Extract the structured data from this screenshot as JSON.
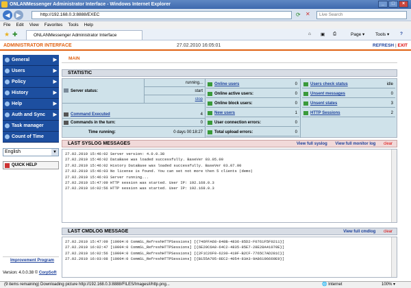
{
  "browser": {
    "window_title": "ONLANMessenger Administrator Interface - Windows Internet Explorer",
    "address": "http://192.168.0.3:8888/EXEC",
    "search_placeholder": "Live Search",
    "menu": [
      "File",
      "Edit",
      "View",
      "Favorites",
      "Tools",
      "Help"
    ],
    "tab_title": "ONLANMessenger Administrator Interface",
    "toolbar": {
      "page": "Page",
      "tools": "Tools"
    },
    "status_text": "(9 items remaining) Downloading picture http://192.168.0.3:8888/FILES/Images/i/http.png...",
    "zone": "Internet",
    "zoom": "100%"
  },
  "app": {
    "header_title": "ADMINISTRATOR INTERFACE",
    "datetime": "27.02.2010 16:05:01",
    "refresh": "REFRESH",
    "exit": "EXIT",
    "main_label": "MAIN",
    "sidebar": [
      {
        "label": "General",
        "arrow": true
      },
      {
        "label": "Users",
        "arrow": true
      },
      {
        "label": "Policy",
        "arrow": true
      },
      {
        "label": "History",
        "arrow": true
      },
      {
        "label": "Help",
        "arrow": true
      },
      {
        "label": "Auth and Sync",
        "arrow": true
      },
      {
        "label": "Task manager",
        "arrow": false
      },
      {
        "label": "Count of Time",
        "arrow": false
      }
    ],
    "language": "English",
    "quick_help": "QUICK HELP",
    "improvement": "Improvement Program",
    "version": "Version: 4.0.0.38",
    "copyright": "CorpSoft"
  },
  "statistic": {
    "title": "STATISTIC",
    "server_status_label": "Server status:",
    "server_state": "running...",
    "start": "start",
    "stop": "stop",
    "commands_executed_label": "Command Executed",
    "commands_executed": "4",
    "commands_turn_label": "Commands in the turn:",
    "commands_turn": "0",
    "time_running_label": "Time running:",
    "time_running": "0 days 00:18:27",
    "col2": [
      {
        "label": "Online users",
        "value": "0",
        "link": true
      },
      {
        "label": "Online active users:",
        "value": "0",
        "link": false
      },
      {
        "label": "Online block users:",
        "value": "0",
        "link": false
      },
      {
        "label": "New users",
        "value": "1",
        "link": true
      },
      {
        "label": "User connection errors:",
        "value": "0",
        "link": false
      },
      {
        "label": "Total upload errors:",
        "value": "0",
        "link": false
      }
    ],
    "col3": [
      {
        "label": "Users check status",
        "value": "idle"
      },
      {
        "label": "Unsent messages",
        "value": "0"
      },
      {
        "label": "Unsent states",
        "value": "3"
      },
      {
        "label": "HTTP Sessions",
        "value": "2"
      }
    ]
  },
  "syslog": {
    "title": "LAST SYSLOG MESSAGES",
    "view_full": "View full syslog",
    "view_monitor": "View full monitor log",
    "clear": "clear",
    "lines": [
      "27.02.2010 15:46:02 Server version: 4.0.0.38",
      "27.02.2010 15:46:02 DataBase was loaded successfully. BaseVer 03.05.00",
      "27.02.2010 15:46:02 History DataBase was loaded successfully. BaseVer 03.07.00",
      "27.02.2010 15:46:03 No license is found. You can set not more then 5 clients (demo)",
      "27.02.2010 15:46:03 Server running...",
      "27.02.2010 15:47:09 HTTP session was started. User IP: 192.168.0.3",
      "27.02.2010 16:02:56 HTTP session was started. User IP: 192.168.0.3"
    ]
  },
  "cmdlog": {
    "title": "LAST CMDLOG MESSAGE",
    "view_full": "View full cmdlog",
    "clear": "clear",
    "lines": [
      "27.02.2010 15:47:09 [10004:0 CommSL_RefreshHTTPSessions] [{746FFA68-848B-4836-85D2-F0761F5F0211}]",
      "27.02.2010 16:02:47 [10004:0 CommSL_RefreshHTTPSessions] [{6E20C6A0-64C2-4835-85E7-28E28A41070E}]",
      "27.02.2010 16:02:56 [10004:0 CommSL_RefreshHTTPSessions] [{2F1C26F0-6230-419F-B2CF-7765C7AD281C}]",
      "27.02.2010 16:03:08 [10004:0 CommSL_RefreshHTTPSessions] [{B155A705-8EC2-4054-83A3-9A86196669E9}]"
    ]
  }
}
